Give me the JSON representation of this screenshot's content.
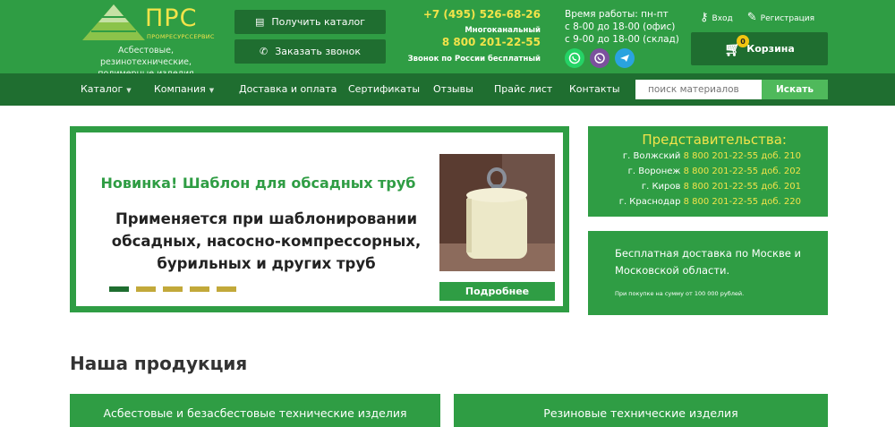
{
  "header": {
    "brand": "ПРС",
    "brand_sub": "ПРОМРЕСУРССЕРВИС",
    "tagline": "Асбестовые, резинотехнические, полимерные изделия",
    "catalog_button": "Получить каталог",
    "call_button": "Заказать звонок",
    "phone_main": "+7 (495) 526-68-26",
    "phone_main_note": "Многоканальный",
    "phone_free": "8 800 201-22-55",
    "phone_free_note": "Звонок по России бесплатный",
    "hours_title": "Время работы: пн-пт",
    "hours_office": "с 8-00 до 18-00 (офис)",
    "hours_warehouse": "с 9-00 до 18-00 (склад)",
    "messengers": [
      "whatsapp-icon",
      "viber-icon",
      "telegram-icon"
    ],
    "login": "Вход",
    "register": "Регистрация",
    "cart_label": "Корзина",
    "cart_count": "0"
  },
  "nav": {
    "items": [
      "Каталог",
      "Компания",
      "Доставка и оплата",
      "Сертификаты",
      "Отзывы",
      "Прайс лист",
      "Контакты"
    ],
    "search_placeholder": "поиск материалов",
    "search_button": "Искать"
  },
  "slider": {
    "title": "Новинка! Шаблон для обсадных труб",
    "text": "Применяется при шаблонировании обсадных, насосно-компрессорных, бурильных и других труб",
    "more_button": "Подробнее",
    "slide_count": 5,
    "active_slide": 1
  },
  "representatives": {
    "title": "Представительства:",
    "items": [
      {
        "city": "г. Волжский",
        "phone": "8 800 201-22-55 доб. 210"
      },
      {
        "city": "г. Воронеж",
        "phone": "8 800 201-22-55 доб. 202"
      },
      {
        "city": "г. Киров",
        "phone": "8 800 201-22-55 доб. 201"
      },
      {
        "city": "г. Краснодар",
        "phone": "8 800 201-22-55 доб. 220"
      }
    ]
  },
  "delivery": {
    "text": "Бесплатная доставка по Москве и Московской области.",
    "note": "При покупке на сумму от 100 000 рублей."
  },
  "products": {
    "title": "Наша продукция",
    "items": [
      "Асбестовые и безасбестовые технические изделия",
      "Резиновые технические изделия"
    ]
  },
  "colors": {
    "brand_green": "#2f9d44",
    "dark_green": "#1f6e30",
    "accent_yellow": "#f2e34a"
  }
}
